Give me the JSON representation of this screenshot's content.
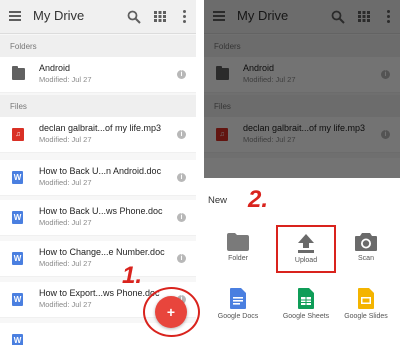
{
  "app": {
    "title": "My Drive",
    "icons": [
      "menu-icon",
      "search-icon",
      "grid-view-icon",
      "more-vert-icon"
    ]
  },
  "sections": {
    "folders": "Folders",
    "files": "Files"
  },
  "folders": [
    {
      "name": "Android",
      "meta": "Modified: Jul 27",
      "icon": "folder-icon"
    }
  ],
  "files": [
    {
      "name": "declan galbrait...of my life.mp3",
      "meta": "Modified: Jul 27",
      "icon": "audio-file-icon",
      "glyph": "♫"
    },
    {
      "name": "How to Back U...n Android.doc",
      "meta": "Modified: Jul 27",
      "icon": "doc-file-icon",
      "glyph": "W"
    },
    {
      "name": "How to Back U...ws Phone.doc",
      "meta": "Modified: Jul 27",
      "icon": "doc-file-icon",
      "glyph": "W"
    },
    {
      "name": "How to Change...e Number.doc",
      "meta": "Modified: Jul 27",
      "icon": "doc-file-icon",
      "glyph": "W"
    },
    {
      "name": "How to Export...ws Phone.doc",
      "meta": "Modified: Jul 27",
      "icon": "doc-file-icon",
      "glyph": "W"
    },
    {
      "name": "",
      "meta": "",
      "icon": "doc-file-icon",
      "glyph": "W"
    }
  ],
  "fab": {
    "glyph": "+"
  },
  "steps": {
    "one": "1.",
    "two": "2."
  },
  "new_sheet": {
    "title": "New",
    "options": [
      {
        "label": "Folder",
        "icon": "folder-icon"
      },
      {
        "label": "Upload",
        "icon": "upload-icon"
      },
      {
        "label": "Scan",
        "icon": "camera-icon"
      },
      {
        "label": "Google Docs",
        "icon": "google-docs-icon"
      },
      {
        "label": "Google Sheets",
        "icon": "google-sheets-icon"
      },
      {
        "label": "Google Slides",
        "icon": "google-slides-icon"
      }
    ]
  },
  "colors": {
    "accent_red": "#d9231d",
    "fab": "#e8453c",
    "doc_blue": "#4a7fe0",
    "sheets_green": "#0f9d58",
    "slides_yellow": "#f4b400"
  }
}
